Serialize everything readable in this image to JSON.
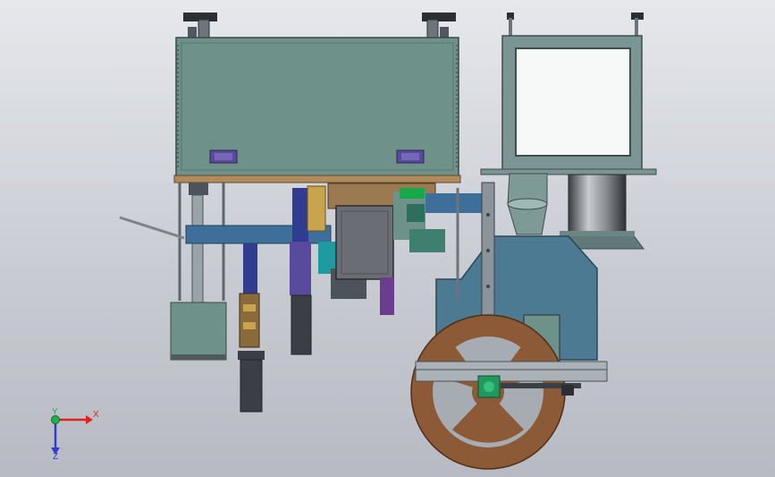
{
  "triad": {
    "x_label": "X",
    "y_label": "Y",
    "z_label": "Z",
    "x_color": "#e0241c",
    "y_color": "#22b14c",
    "z_color": "#2f3ad4"
  },
  "palette": {
    "background_top": "#e6e8ec",
    "background_bottom": "#b7bac2",
    "housing_fill": "#6f9088",
    "frame_fill": "#7a9594",
    "beam_blue": "#3d6f9a",
    "motor_dark": "#3b3f45",
    "wheel_brown": "#8c5a36",
    "window_white": "#f7f8f8",
    "accent_purple": "#5a4a9e"
  }
}
